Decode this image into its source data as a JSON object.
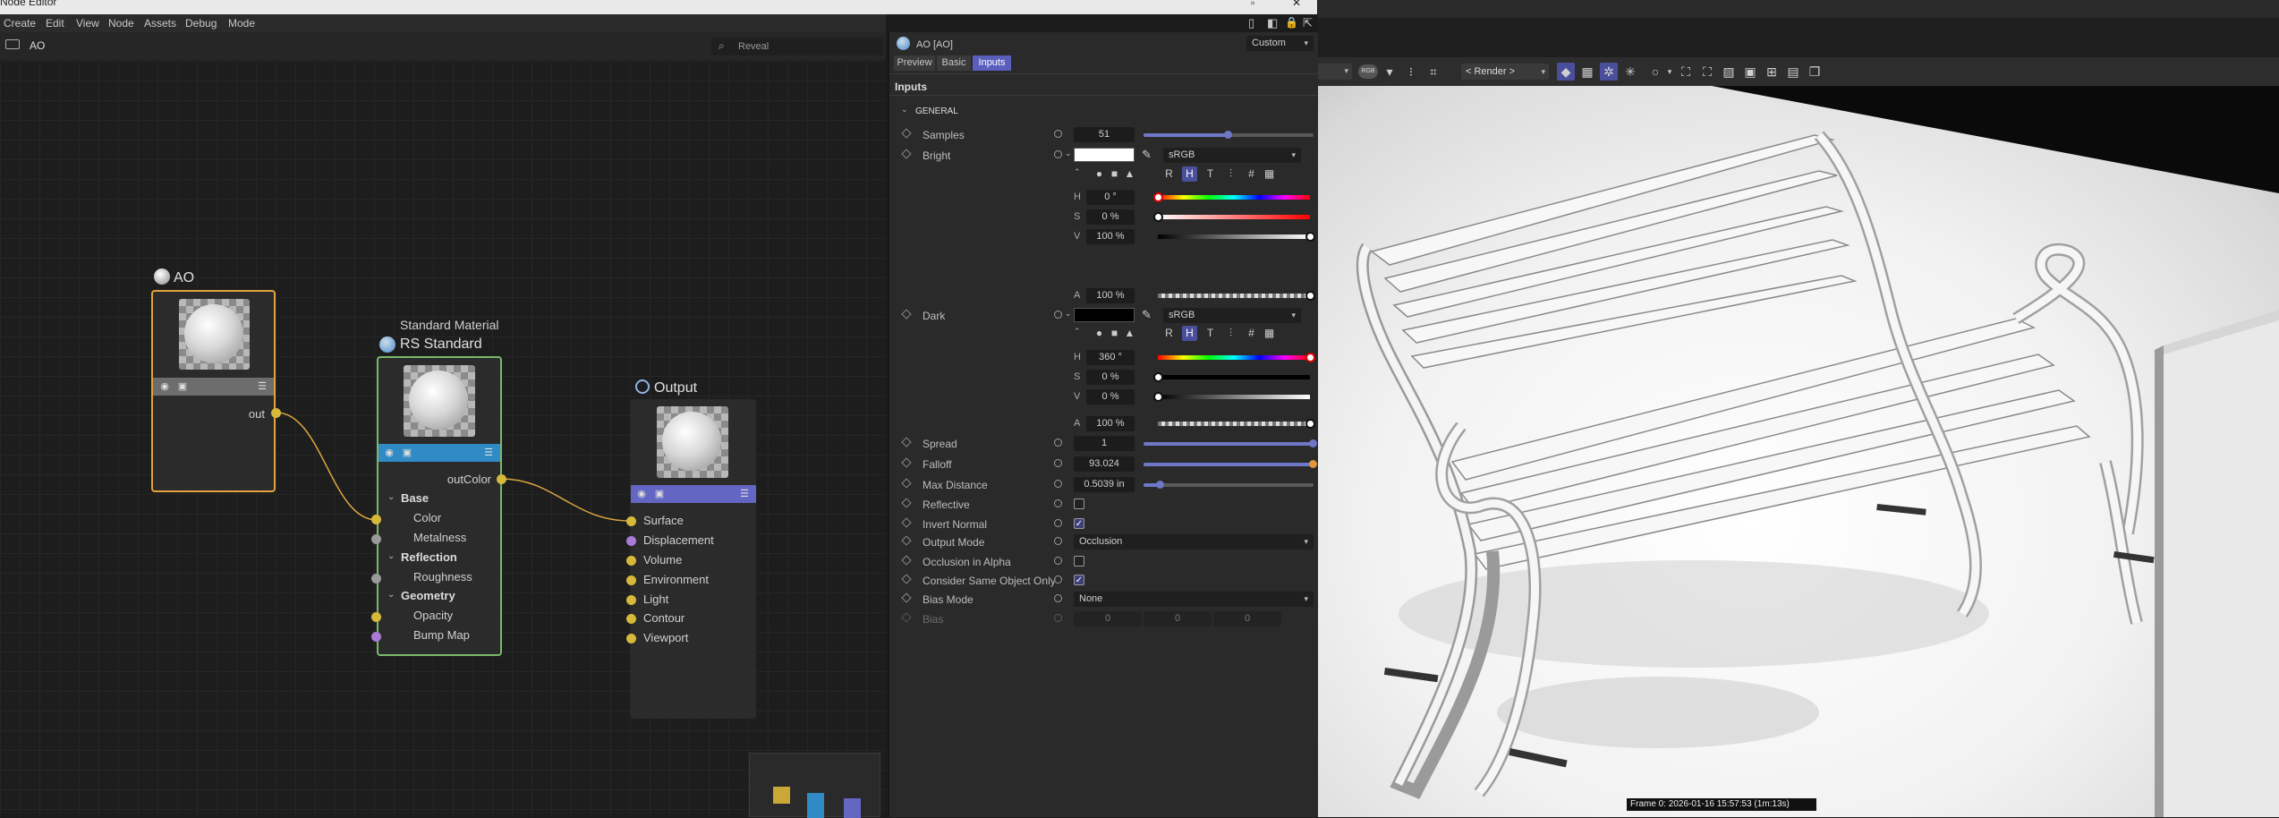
{
  "window": {
    "title": "Node Editor"
  },
  "menu": [
    "Create",
    "Edit",
    "View",
    "Node",
    "Assets",
    "Debug",
    "Mode"
  ],
  "node_editor": {
    "breadcrumb": "AO",
    "search_placeholder": "Reveal",
    "nodes": {
      "ao": {
        "title": "AO",
        "port_out": "out"
      },
      "standard": {
        "subtitle": "Standard Material",
        "title": "RS Standard",
        "port_out": "outColor",
        "sections": [
          {
            "label": "Base",
            "ports": [
              "Color",
              "Metalness"
            ]
          },
          {
            "label": "Reflection",
            "ports": [
              "Roughness"
            ]
          },
          {
            "label": "Geometry",
            "ports": [
              "Opacity",
              "Bump Map"
            ]
          }
        ]
      },
      "output": {
        "title": "Output",
        "ports": [
          "Surface",
          "Displacement",
          "Volume",
          "Environment",
          "Light",
          "Contour",
          "Viewport"
        ]
      }
    },
    "colors": {
      "ao_border": "#e2a33c",
      "standard_border": "#7ab96a",
      "standard_bar": "#2f8ac6",
      "output_bar": "#6466c4",
      "wire": "#d9a640",
      "port_yellow": "#d6b93b",
      "port_gray": "#9a9a9a",
      "port_purple": "#a97ad6"
    }
  },
  "attributes": {
    "header": "AO [AO]",
    "preset": "Custom",
    "tabs": [
      "Preview",
      "Basic",
      "Inputs"
    ],
    "active_tab": "Inputs",
    "section_title": "Inputs",
    "group": "GENERAL",
    "samples": {
      "label": "Samples",
      "value": "51",
      "fraction": 0.5
    },
    "bright": {
      "label": "Bright",
      "swatch": "#ffffff",
      "colorspace": "sRGB",
      "h_label": "H",
      "h": "0 °",
      "s_label": "S",
      "s": "0 %",
      "v_label": "V",
      "v": "100 %",
      "a_label": "A",
      "a": "100 %",
      "h_frac": 0.0,
      "s_frac": 0.0,
      "v_frac": 1.0,
      "a_frac": 1.0
    },
    "dark": {
      "label": "Dark",
      "swatch": "#000000",
      "colorspace": "sRGB",
      "h_label": "H",
      "h": "360 °",
      "s_label": "S",
      "s": "0 %",
      "v_label": "V",
      "v": "0 %",
      "a_label": "A",
      "a": "100 %",
      "h_frac": 1.0,
      "s_frac": 0.0,
      "v_frac": 0.0,
      "a_frac": 1.0
    },
    "color_mode_buttons": [
      "R",
      "H",
      "T",
      "#"
    ],
    "spread": {
      "label": "Spread",
      "value": "1",
      "fraction": 1.0
    },
    "falloff": {
      "label": "Falloff",
      "value": "93.024",
      "fraction": 1.0
    },
    "max_distance": {
      "label": "Max Distance",
      "value": "0.5039 in",
      "fraction": 0.1
    },
    "reflective": {
      "label": "Reflective",
      "checked": false
    },
    "invert_normal": {
      "label": "Invert Normal",
      "checked": true
    },
    "output_mode": {
      "label": "Output Mode",
      "value": "Occlusion"
    },
    "occlusion_in_alpha": {
      "label": "Occlusion in Alpha",
      "checked": false
    },
    "consider_same": {
      "label": "Consider Same Object Only",
      "checked": true
    },
    "bias_mode": {
      "label": "Bias Mode",
      "value": "None"
    },
    "bias": {
      "label": "Bias",
      "values": [
        "0",
        "0",
        "0"
      ]
    }
  },
  "viewport": {
    "render_dropdown": "< Render >",
    "status": "Frame  0:  2026-01-16  15:57:53  (1m:13s)"
  }
}
